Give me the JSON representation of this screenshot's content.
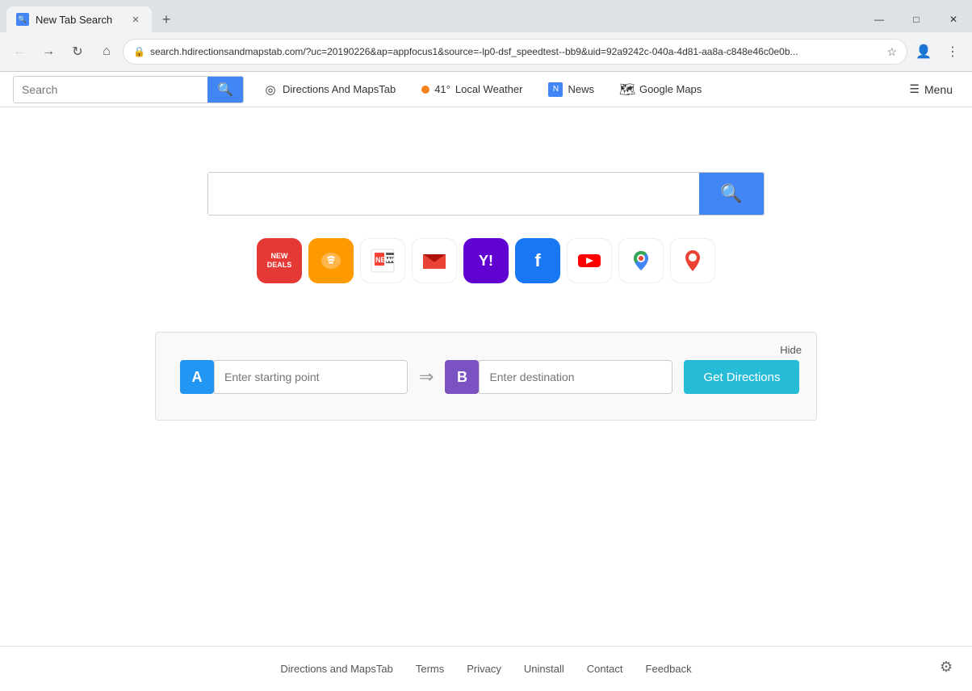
{
  "browser": {
    "tab_title": "New Tab Search",
    "new_tab_label": "+",
    "address": "search.hdirectionsandmapstab.com/?uc=20190226&ap=appfocus1&source=-lp0-dsf_speedtest--bb9&uid=92a9242c-040a-4d81-aa8a-c848e46c0e0b...",
    "win_minimize": "—",
    "win_maximize": "□",
    "win_close": "✕"
  },
  "toolbar": {
    "search_placeholder": "Search",
    "search_btn_icon": "🔍",
    "directions_label": "Directions And MapsTab",
    "weather_temp": "41°",
    "weather_label": "Local Weather",
    "news_label": "News",
    "google_maps_label": "Google Maps",
    "menu_label": "Menu",
    "menu_icon": "☰"
  },
  "main": {
    "search_placeholder": "",
    "search_btn_icon": "🔍"
  },
  "quick_links": [
    {
      "id": "new-deals",
      "label": "NEW\nDEALS",
      "bg": "#e53935"
    },
    {
      "id": "audible",
      "label": "🎧",
      "bg": "#f90"
    },
    {
      "id": "news",
      "label": "📰",
      "bg": "#fff"
    },
    {
      "id": "gmail",
      "label": "✉",
      "bg": "#fff"
    },
    {
      "id": "yahoo",
      "label": "Y!",
      "bg": "#6001d2"
    },
    {
      "id": "facebook",
      "label": "f",
      "bg": "#1877f2"
    },
    {
      "id": "youtube",
      "label": "▶",
      "bg": "#fff"
    },
    {
      "id": "gmaps",
      "label": "📍",
      "bg": "#fff"
    },
    {
      "id": "maps-pin",
      "label": "📌",
      "bg": "#fff"
    }
  ],
  "directions": {
    "hide_label": "Hide",
    "point_a_label": "A",
    "point_b_label": "B",
    "start_placeholder": "Enter starting point",
    "dest_placeholder": "Enter destination",
    "get_directions_label": "Get Directions",
    "arrow": "⇒"
  },
  "footer": {
    "links": [
      {
        "label": "Directions and MapsTab"
      },
      {
        "label": "Terms"
      },
      {
        "label": "Privacy"
      },
      {
        "label": "Uninstall"
      },
      {
        "label": "Contact"
      },
      {
        "label": "Feedback"
      }
    ],
    "settings_icon": "⚙"
  }
}
